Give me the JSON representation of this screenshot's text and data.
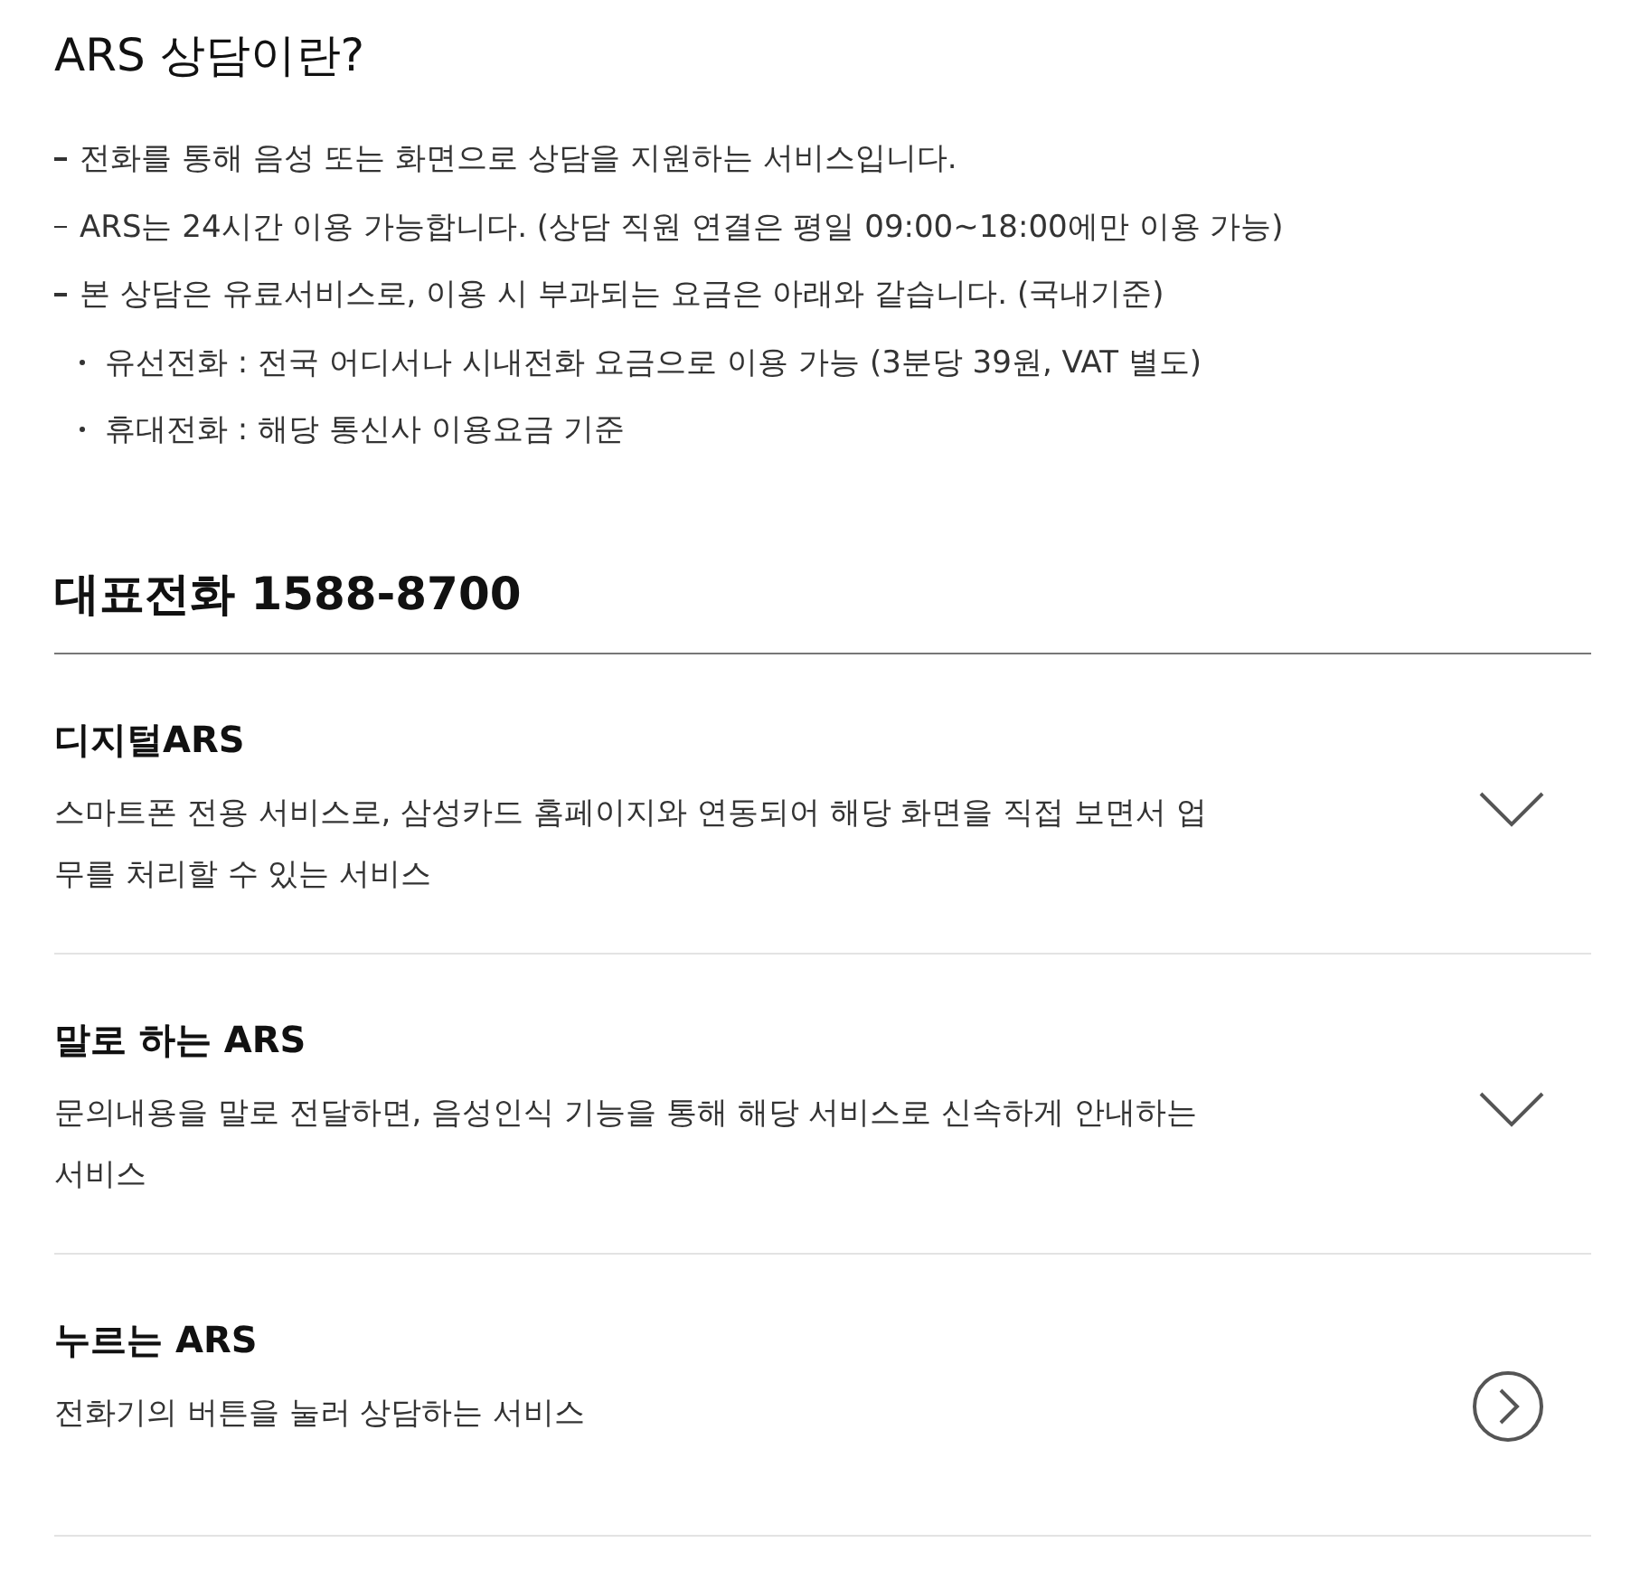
{
  "intro": {
    "title": "ARS 상담이란?",
    "lines": [
      {
        "kind": "dash",
        "text": "전화를 통해 음성 또는 화면으로 상담을 지원하는 서비스입니다."
      },
      {
        "kind": "dash",
        "text": "ARS는 24시간 이용 가능합니다. (상담 직원 연결은 평일 09:00~18:00에만 이용 가능)"
      },
      {
        "kind": "dash",
        "text": "본 상담은 유료서비스로, 이용 시 부과되는 요금은 아래와 같습니다. (국내기준)"
      },
      {
        "kind": "dot",
        "text": "유선전화 : 전국 어디서나 시내전화 요금으로 이용 가능 (3분당 39원, VAT 별도)"
      },
      {
        "kind": "dot",
        "text": "휴대전화 : 해당 통신사 이용요금 기준"
      }
    ]
  },
  "phone": {
    "title": "대표전화 1588-8700"
  },
  "services": [
    {
      "kind": "expand",
      "expanded": false,
      "title": "디지털ARS",
      "description": "스마트폰 전용 서비스로, 삼성카드 홈페이지와 연동되어 해당 화면을 직접 보면서 업무를 처리할 수 있는 서비스"
    },
    {
      "kind": "expand",
      "expanded": false,
      "title": "말로 하는 ARS",
      "description": "문의내용을 말로 전달하면, 음성인식 기능을 통해 해당 서비스로 신속하게 안내하는 서비스"
    },
    {
      "kind": "link",
      "title": "누르는 ARS",
      "description": "전화기의 버튼을 눌러 상담하는 서비스"
    }
  ]
}
